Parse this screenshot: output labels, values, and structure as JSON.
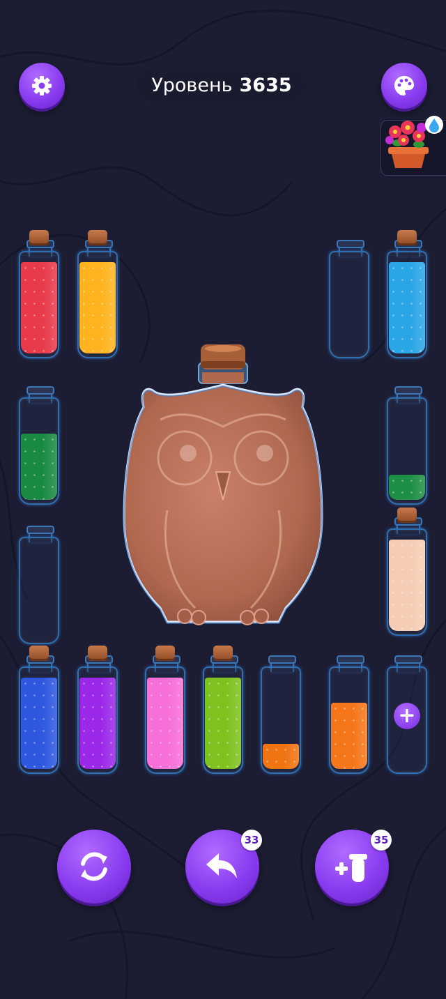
{
  "header": {
    "level_label": "Уровень",
    "level_number": "3635"
  },
  "icons": {
    "settings": "gear-icon",
    "theme": "palette-icon",
    "shop": "flower-pot-icon",
    "restart": "restart-icon",
    "undo": "undo-icon",
    "add_tube": "add-tube-icon"
  },
  "buttons": {
    "undo_count": "33",
    "add_tube_count": "35"
  },
  "tubes": [
    {
      "id": "tube-1",
      "color": "#e83a4a",
      "fill": 0.92,
      "corked": true
    },
    {
      "id": "tube-2",
      "color": "#ffb41f",
      "fill": 0.92,
      "corked": true
    },
    {
      "id": "tube-3",
      "color": "empty",
      "fill": 0,
      "corked": false
    },
    {
      "id": "tube-4",
      "color": "#2aa6e6",
      "fill": 0.92,
      "corked": true
    },
    {
      "id": "tube-5",
      "color": "#1a8a43",
      "fill": 0.67,
      "corked": false
    },
    {
      "id": "tube-6",
      "color": "#1f8f45",
      "fill": 0.25,
      "corked": false
    },
    {
      "id": "tube-7",
      "color": "empty",
      "fill": 0,
      "corked": false
    },
    {
      "id": "tube-8",
      "color": "#f6cdb4",
      "fill": 0.92,
      "corked": true
    },
    {
      "id": "tube-9",
      "color": "#2f57e0",
      "fill": 0.92,
      "corked": true
    },
    {
      "id": "tube-10",
      "color": "#9b28e8",
      "fill": 0.92,
      "corked": true
    },
    {
      "id": "tube-11",
      "color": "#f76fd8",
      "fill": 0.92,
      "corked": true
    },
    {
      "id": "tube-12",
      "color": "#7fc21f",
      "fill": 0.92,
      "corked": true
    },
    {
      "id": "tube-13",
      "color": "#f07412",
      "fill": 0.25,
      "corked": false
    },
    {
      "id": "tube-14",
      "color": "#f5761a",
      "fill": 0.67,
      "corked": false
    },
    {
      "id": "tube-15",
      "color": "empty",
      "fill": 0,
      "corked": false,
      "locked": true
    }
  ],
  "owl_bottle": {
    "color": "#b8705a",
    "corked": true
  },
  "colors": {
    "accent": "#8a3df0",
    "background": "#1c1d33",
    "glass_outline": "#2f6fb0"
  }
}
